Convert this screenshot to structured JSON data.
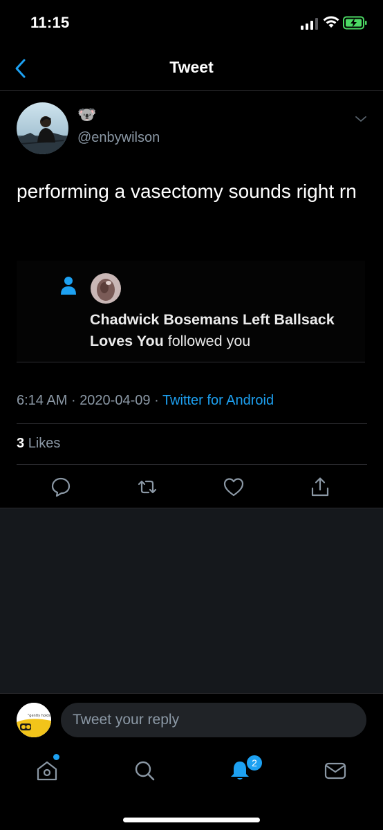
{
  "status": {
    "time": "11:15",
    "battery_color": "#4cd964"
  },
  "nav": {
    "title": "Tweet",
    "accent": "#1da1f2"
  },
  "tweet": {
    "emoji": "🐨",
    "handle": "@enbywilson",
    "text": "performing a vasectomy sounds right rn",
    "quoted_notification": {
      "name": "Chadwick Bosemans Left Ballsack Loves You",
      "action": "followed you"
    },
    "time": "6:14 AM",
    "separator": "·",
    "date": "2020-04-09",
    "source": "Twitter for Android",
    "likes_count": "3",
    "likes_label": "Likes",
    "actions": [
      "reply-icon",
      "retweet-icon",
      "like-icon",
      "share-icon"
    ]
  },
  "reply": {
    "placeholder": "Tweet your reply",
    "avatar_caption": "\"gently holds"
  },
  "tabs": {
    "items": [
      "home-icon",
      "search-icon",
      "notifications-icon",
      "messages-icon"
    ],
    "notification_count": "2"
  },
  "colors": {
    "background": "#000000",
    "secondary_text": "#8b98a5",
    "link": "#1da1f2",
    "panel": "#15181c"
  }
}
